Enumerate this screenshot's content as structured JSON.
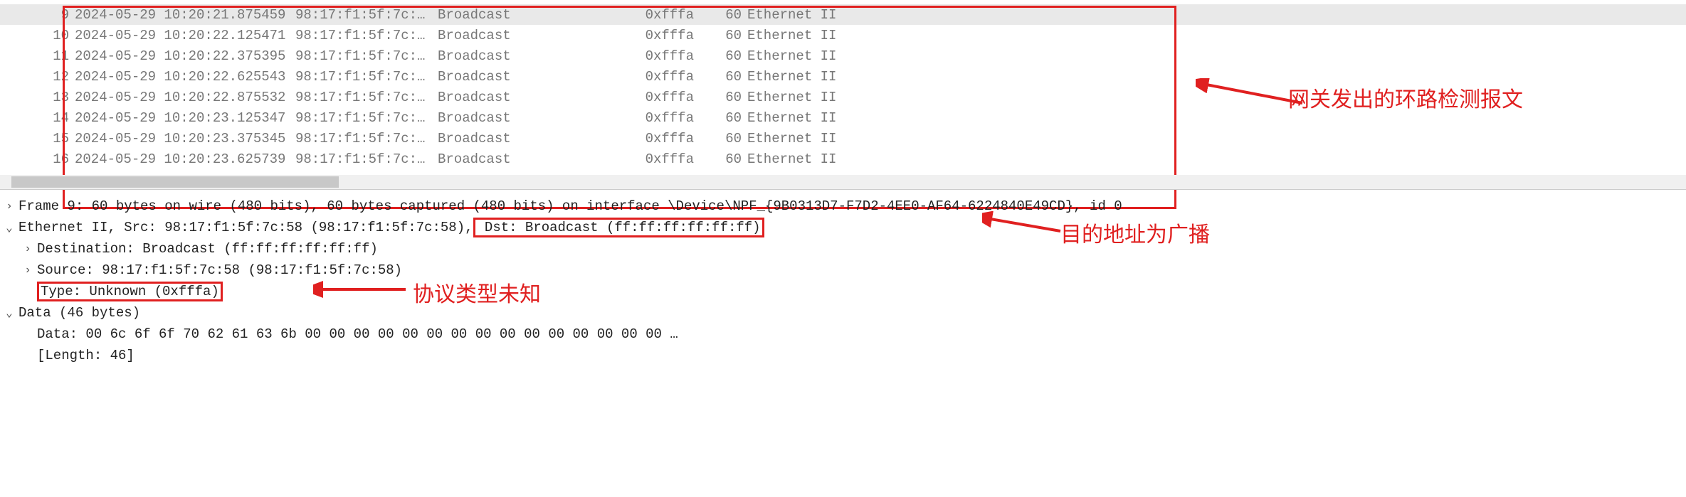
{
  "packets": [
    {
      "no": "9",
      "time": "2024-05-29 10:20:21.875459",
      "src": "98:17:f1:5f:7c:…",
      "dst": "Broadcast",
      "proto": "0xfffa",
      "len": "60",
      "info": "Ethernet II",
      "selected": true
    },
    {
      "no": "10",
      "time": "2024-05-29 10:20:22.125471",
      "src": "98:17:f1:5f:7c:…",
      "dst": "Broadcast",
      "proto": "0xfffa",
      "len": "60",
      "info": "Ethernet II"
    },
    {
      "no": "11",
      "time": "2024-05-29 10:20:22.375395",
      "src": "98:17:f1:5f:7c:…",
      "dst": "Broadcast",
      "proto": "0xfffa",
      "len": "60",
      "info": "Ethernet II"
    },
    {
      "no": "12",
      "time": "2024-05-29 10:20:22.625543",
      "src": "98:17:f1:5f:7c:…",
      "dst": "Broadcast",
      "proto": "0xfffa",
      "len": "60",
      "info": "Ethernet II"
    },
    {
      "no": "13",
      "time": "2024-05-29 10:20:22.875532",
      "src": "98:17:f1:5f:7c:…",
      "dst": "Broadcast",
      "proto": "0xfffa",
      "len": "60",
      "info": "Ethernet II"
    },
    {
      "no": "14",
      "time": "2024-05-29 10:20:23.125347",
      "src": "98:17:f1:5f:7c:…",
      "dst": "Broadcast",
      "proto": "0xfffa",
      "len": "60",
      "info": "Ethernet II"
    },
    {
      "no": "15",
      "time": "2024-05-29 10:20:23.375345",
      "src": "98:17:f1:5f:7c:…",
      "dst": "Broadcast",
      "proto": "0xfffa",
      "len": "60",
      "info": "Ethernet II"
    },
    {
      "no": "16",
      "time": "2024-05-29 10:20:23.625739",
      "src": "98:17:f1:5f:7c:…",
      "dst": "Broadcast",
      "proto": "0xfffa",
      "len": "60",
      "info": "Ethernet II"
    }
  ],
  "details": {
    "frame_line": "Frame 9: 60 bytes on wire (480 bits), 60 bytes captured (480 bits) on interface \\Device\\NPF_{9B0313D7-F7D2-4EE0-AF64-6224840E49CD}, id 0",
    "eth_prefix": "Ethernet II, Src: 98:17:f1:5f:7c:58 (98:17:f1:5f:7c:58),",
    "eth_dst": " Dst: Broadcast (ff:ff:ff:ff:ff:ff)",
    "dest_line": "Destination: Broadcast (ff:ff:ff:ff:ff:ff)",
    "src_line": "Source: 98:17:f1:5f:7c:58 (98:17:f1:5f:7c:58)",
    "type_line": "Type: Unknown (0xfffa)",
    "data_hdr": "Data (46 bytes)",
    "data_hex": "Data: 00 6c 6f 6f 70 62 61 63 6b 00 00 00 00 00 00 00 00 00 00 00 00 00 00 00 …",
    "data_len": "[Length: 46]"
  },
  "annotations": {
    "a1": "网关发出的环路检测报文",
    "a2": "目的地址为广播",
    "a3": "协议类型未知"
  },
  "glyphs": {
    "right": "›",
    "down": "⌄"
  }
}
